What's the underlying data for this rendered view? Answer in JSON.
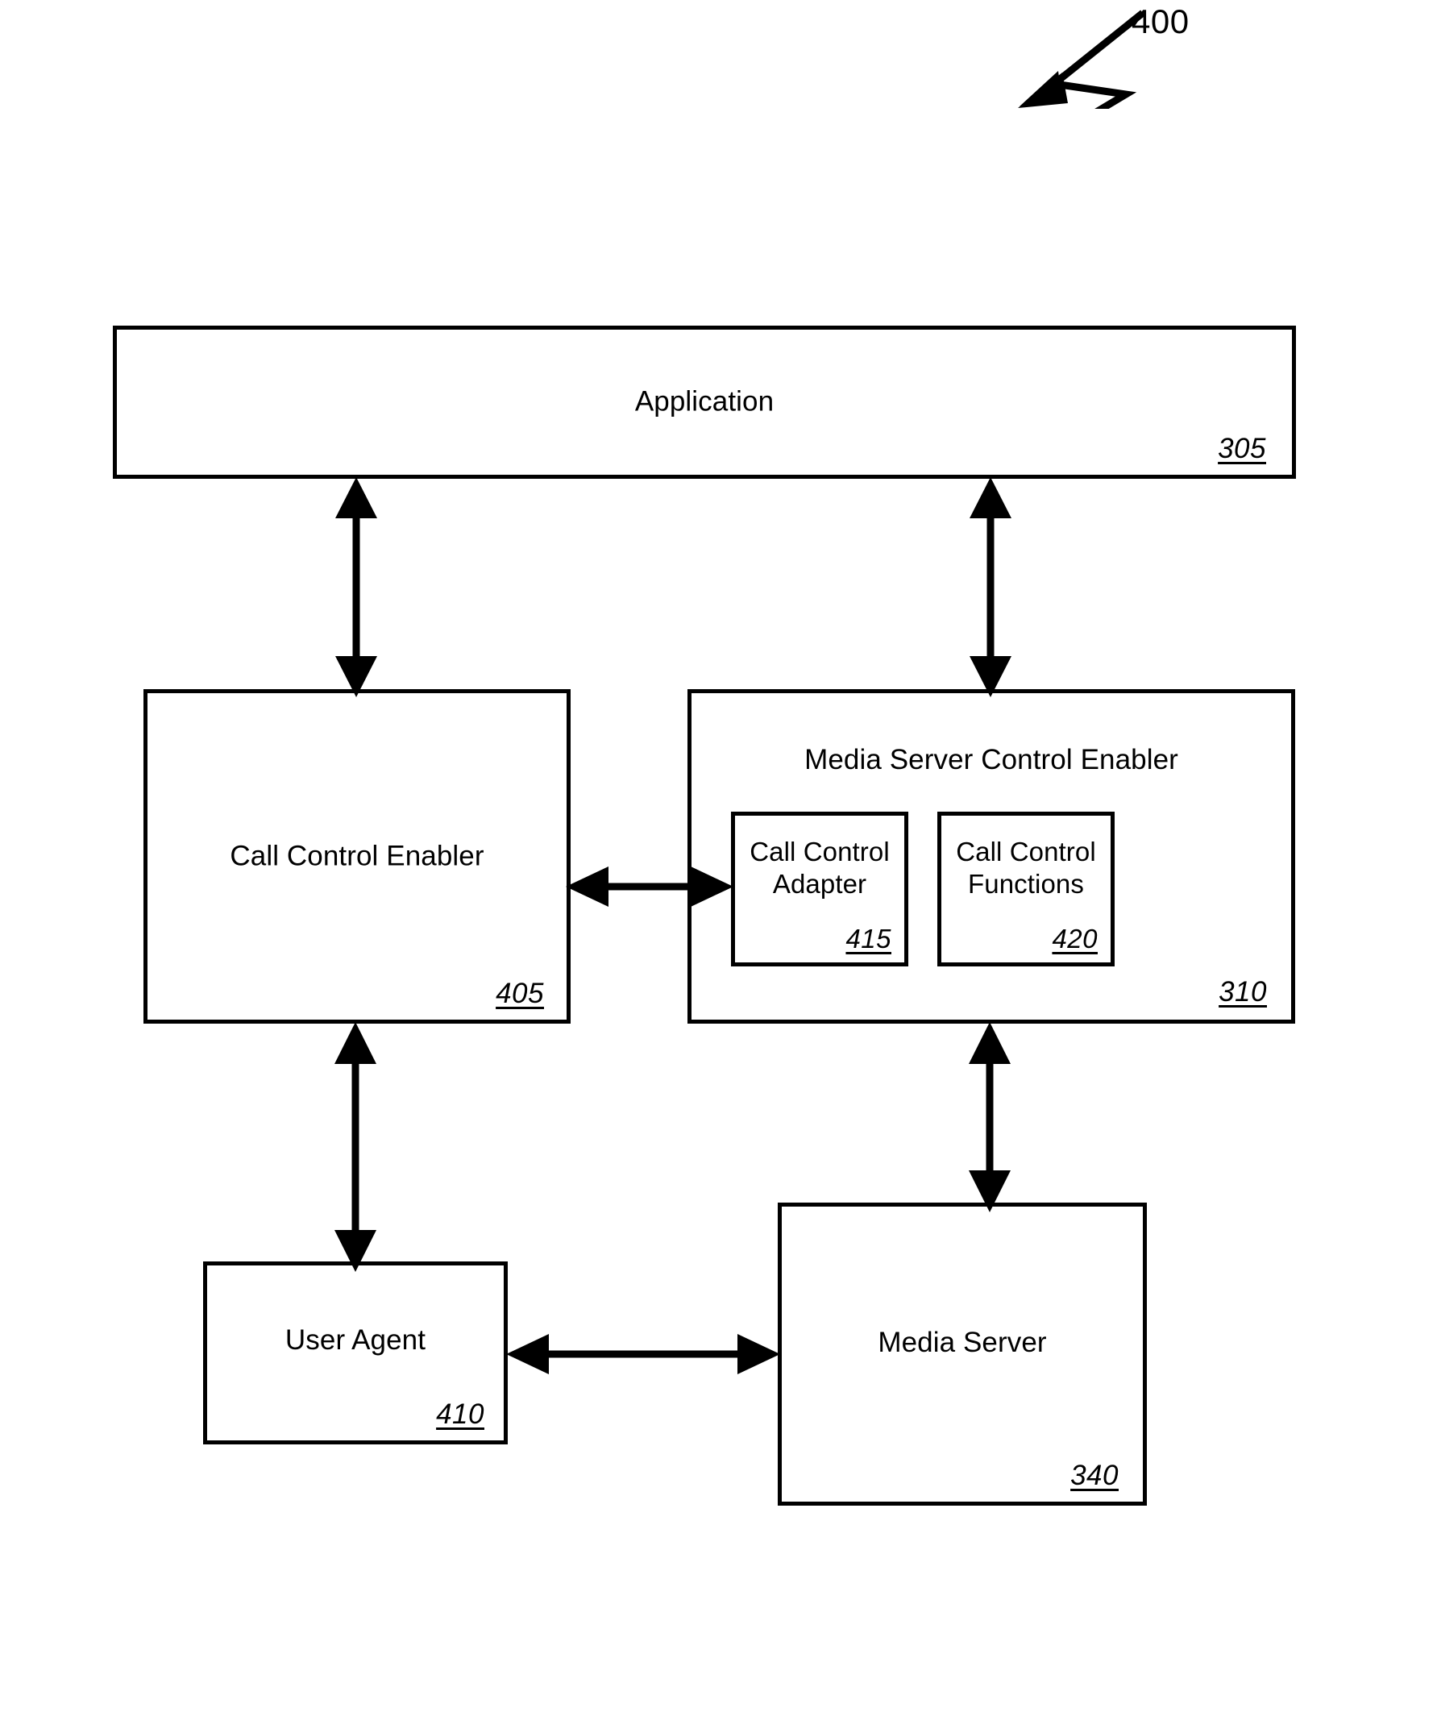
{
  "figure": {
    "number": "400",
    "pointer_icon": "lightning-bolt-arrow-icon"
  },
  "blocks": [
    {
      "id": "application",
      "label": "Application",
      "ref": "305"
    },
    {
      "id": "call-control-enabler",
      "label": "Call Control Enabler",
      "ref": "405"
    },
    {
      "id": "media-server-control-enabler",
      "label": "Media Server Control Enabler",
      "ref": "310"
    },
    {
      "id": "call-control-adapter",
      "label": "Call Control\nAdapter",
      "ref": "415"
    },
    {
      "id": "call-control-functions",
      "label": "Call Control\nFunctions",
      "ref": "420"
    },
    {
      "id": "user-agent",
      "label": "User Agent",
      "ref": "410"
    },
    {
      "id": "media-server",
      "label": "Media Server",
      "ref": "340"
    }
  ],
  "application": {
    "label": "Application",
    "ref": "305"
  },
  "call_control_enabler": {
    "label": "Call Control Enabler",
    "ref": "405"
  },
  "media_server_control_enabler": {
    "label": "Media Server Control Enabler",
    "ref": "310"
  },
  "call_control_adapter": {
    "label": "Call Control\nAdapter",
    "ref": "415"
  },
  "call_control_functions": {
    "label": "Call Control\nFunctions",
    "ref": "420"
  },
  "user_agent": {
    "label": "User Agent",
    "ref": "410"
  },
  "media_server": {
    "label": "Media Server",
    "ref": "340"
  },
  "connectors": [
    {
      "id": "application-to-call-control-enabler",
      "from": "application",
      "to": "call-control-enabler",
      "direction": "bidirectional",
      "orientation": "vertical"
    },
    {
      "id": "application-to-media-server-control-enabler",
      "from": "application",
      "to": "media-server-control-enabler",
      "direction": "bidirectional",
      "orientation": "vertical"
    },
    {
      "id": "call-control-enabler-to-call-control-adapter",
      "from": "call-control-enabler",
      "to": "call-control-adapter",
      "direction": "bidirectional",
      "orientation": "horizontal"
    },
    {
      "id": "call-control-enabler-to-user-agent",
      "from": "call-control-enabler",
      "to": "user-agent",
      "direction": "bidirectional",
      "orientation": "vertical"
    },
    {
      "id": "media-server-control-enabler-to-media-server",
      "from": "media-server-control-enabler",
      "to": "media-server",
      "direction": "bidirectional",
      "orientation": "vertical"
    },
    {
      "id": "user-agent-to-media-server",
      "from": "user-agent",
      "to": "media-server",
      "direction": "bidirectional",
      "orientation": "horizontal"
    }
  ],
  "colors": {
    "stroke": "#000000",
    "background": "#ffffff",
    "text": "#000000"
  }
}
